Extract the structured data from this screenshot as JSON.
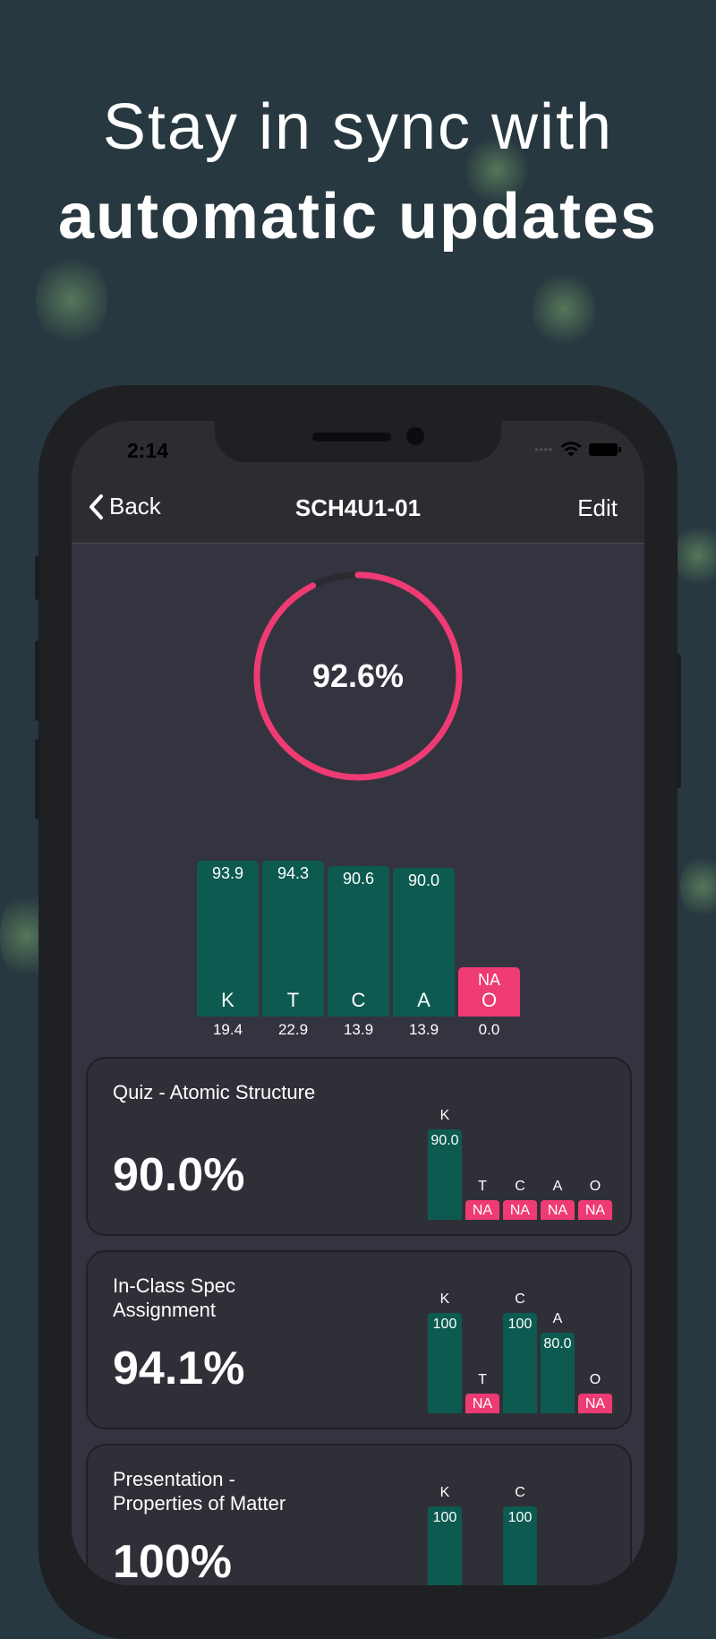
{
  "headline": {
    "line1": "Stay in sync with",
    "line2": "automatic updates"
  },
  "status_bar": {
    "time": "2:14"
  },
  "nav": {
    "back_label": "Back",
    "title": "SCH4U1-01",
    "edit_label": "Edit"
  },
  "overall": {
    "percent_label": "92.6%",
    "progress": 0.926,
    "color": "#ee3b73"
  },
  "categories": [
    {
      "letter": "K",
      "value_label": "93.9",
      "value": 93.9,
      "weight": "19.4"
    },
    {
      "letter": "T",
      "value_label": "94.3",
      "value": 94.3,
      "weight": "22.9"
    },
    {
      "letter": "C",
      "value_label": "90.6",
      "value": 90.6,
      "weight": "13.9"
    },
    {
      "letter": "A",
      "value_label": "90.0",
      "value": 90.0,
      "weight": "13.9"
    },
    {
      "letter": "O",
      "value_label": "NA",
      "value": null,
      "weight": "0.0"
    }
  ],
  "assessments": [
    {
      "title": "Quiz - Atomic Structure",
      "score": "90.0%",
      "marks": [
        {
          "letter": "K",
          "label": "90.0",
          "value": 90.0
        },
        {
          "letter": "T",
          "label": "NA",
          "value": null
        },
        {
          "letter": "C",
          "label": "NA",
          "value": null
        },
        {
          "letter": "A",
          "label": "NA",
          "value": null
        },
        {
          "letter": "O",
          "label": "NA",
          "value": null
        }
      ]
    },
    {
      "title": "In-Class Spec Assignment",
      "score": "94.1%",
      "marks": [
        {
          "letter": "K",
          "label": "100",
          "value": 100
        },
        {
          "letter": "T",
          "label": "NA",
          "value": null
        },
        {
          "letter": "C",
          "label": "100",
          "value": 100
        },
        {
          "letter": "A",
          "label": "80.0",
          "value": 80.0
        },
        {
          "letter": "O",
          "label": "NA",
          "value": null
        }
      ]
    },
    {
      "title": "Presentation - Properties of Matter",
      "score": "100%",
      "marks": [
        {
          "letter": "K",
          "label": "100",
          "value": 100
        },
        {
          "letter": "C",
          "label": "100",
          "value": 100
        }
      ]
    }
  ],
  "colors": {
    "bar_green": "#0d5b50",
    "na_pink": "#ee3b73",
    "screen_bg": "#343440"
  }
}
